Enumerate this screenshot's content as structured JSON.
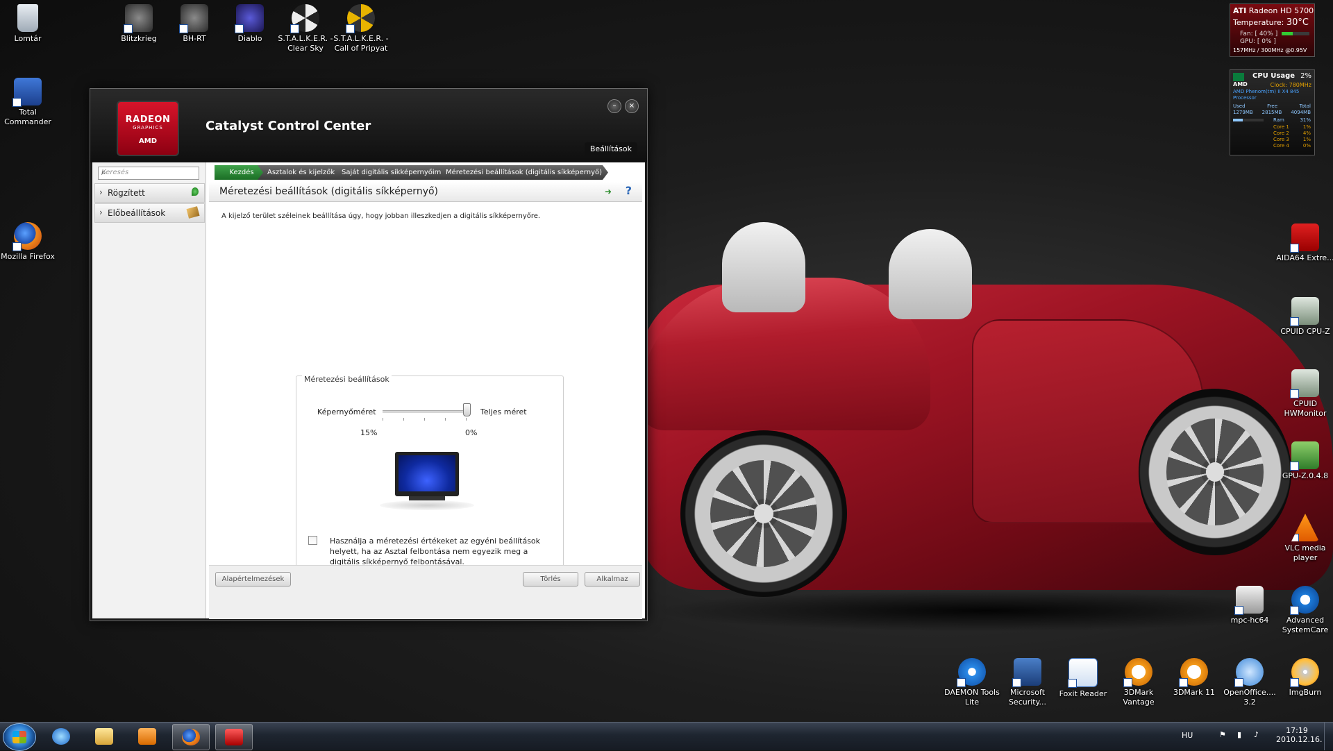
{
  "desktop": {
    "icons": [
      {
        "label": "Lomtár"
      },
      {
        "label": "Blitzkrieg"
      },
      {
        "label": "BH-RT"
      },
      {
        "label": "Diablo"
      },
      {
        "label": "S.T.A.L.K.E.R. - Clear Sky"
      },
      {
        "label": "S.T.A.L.K.E.R. - Call of Pripyat"
      },
      {
        "label": "Total Commander"
      },
      {
        "label": "Mozilla Firefox"
      },
      {
        "label": "AIDA64 Extre..."
      },
      {
        "label": "CPUID CPU-Z"
      },
      {
        "label": "CPUID HWMonitor"
      },
      {
        "label": "GPU-Z.0.4.8"
      },
      {
        "label": "VLC media player"
      },
      {
        "label": "mpc-hc64"
      },
      {
        "label": "Advanced SystemCare"
      },
      {
        "label": "DAEMON Tools Lite"
      },
      {
        "label": "Microsoft Security..."
      },
      {
        "label": "Foxit Reader"
      },
      {
        "label": "3DMark Vantage"
      },
      {
        "label": "3DMark 11"
      },
      {
        "label": "OpenOffice.... 3.2"
      },
      {
        "label": "ImgBurn"
      }
    ]
  },
  "gpu_gadget": {
    "brand": "ATI",
    "model": "Radeon HD 5700",
    "temperature_label": "Temperature:",
    "temperature_value": "30°C",
    "fan": "Fan: [ 40% ]",
    "gpu": "GPU: [ 0% ]",
    "clocks": "157MHz / 300MHz @0.95V"
  },
  "cpu_gadget": {
    "title": "CPU Usage",
    "usage": "2%",
    "brand": "AMD",
    "clock": "Clock: 780MHz",
    "processor": "AMD Phenom(tm) II X4 845 Processor",
    "mem_headers": [
      "Used",
      "Free",
      "Total"
    ],
    "mem_values": [
      "1279MB",
      "2815MB",
      "4094MB"
    ],
    "ram_label": "Ram",
    "ram_value": "31%",
    "cores": [
      {
        "label": "Core 1",
        "value": "1%"
      },
      {
        "label": "Core 2",
        "value": "4%"
      },
      {
        "label": "Core 3",
        "value": "1%"
      },
      {
        "label": "Core 4",
        "value": "0%"
      }
    ]
  },
  "ccc": {
    "logo": {
      "line1": "RADEON",
      "line2": "GRAPHICS",
      "line3": "AMD"
    },
    "title": "Catalyst Control Center",
    "preferences_label": "Beállítások",
    "window_buttons": {
      "minimize": "–",
      "close": "×"
    },
    "search_placeholder": "Keresés",
    "sidebar": [
      {
        "label": "Rögzített"
      },
      {
        "label": "Előbeállítások"
      }
    ],
    "breadcrumb": [
      {
        "label": "Kezdés"
      },
      {
        "label": "Asztalok és kijelzők"
      },
      {
        "label": "Saját digitális síkképernyőim"
      },
      {
        "label": "Méretezési beállítások (digitális síkképernyő)"
      }
    ],
    "page_title": "Méretezési beállítások (digitális síkképernyő)",
    "description": "A kijelző terület széleinek beállítása úgy, hogy jobban illeszkedjen a digitális síkképernyőre.",
    "group": {
      "title": "Méretezési beállítások",
      "slider_left_label": "Képernyőméret",
      "slider_right_label": "Teljes méret",
      "slider_min_text": "15%",
      "slider_max_text": "0%",
      "slider_value_percent": "0%",
      "checkbox_checked": false,
      "checkbox_label": "Használja a méretezési értékeket az egyéni beállítások helyett, ha az Asztal felbontása nem egyezik meg a digitális síkképernyő felbontásával."
    },
    "buttons": {
      "defaults": "Alapértelmezések",
      "discard": "Törlés",
      "apply": "Alkalmaz"
    }
  },
  "taskbar": {
    "language": "HU",
    "time": "17:19",
    "date": "2010.12.16."
  },
  "colors": {
    "ccc_red": "#c4121f",
    "breadcrumb_active": "#2c8a36",
    "taskbar": "#1e2530"
  }
}
